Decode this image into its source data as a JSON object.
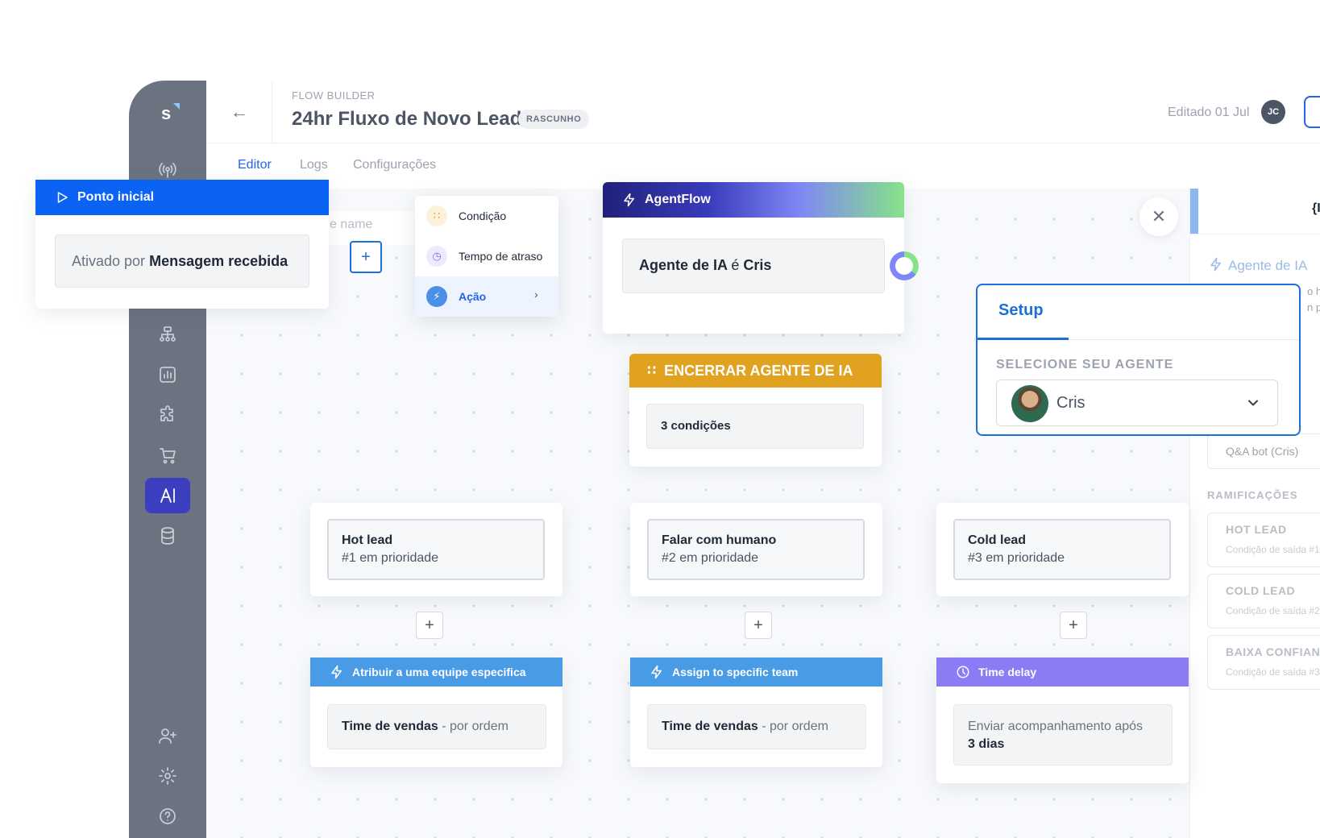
{
  "app": {
    "logo_letter": "s",
    "breadcrumb": "FLOW BUILDER",
    "title": "24hr Fluxo de Novo Lead",
    "status_badge": "RASCUNHO",
    "edited": "Editado 01 Jul",
    "user_initials": "JC"
  },
  "tabs": [
    "Editor",
    "Logs",
    "Configurações"
  ],
  "sidebar": {
    "icons": [
      "broadcast-icon",
      "flow-tree-icon",
      "chart-icon",
      "puzzle-icon",
      "cart-icon",
      "ai-icon",
      "database-icon",
      "add-user-icon",
      "gear-icon",
      "help-icon"
    ],
    "active": "ai-icon"
  },
  "canvas": {
    "name_placeholder_fragment": "e name",
    "start_node": {
      "title": "Ponto inicial",
      "trigger_prefix": "Ativado por",
      "trigger_value": "Mensagem recebida",
      "color": "#0b63f6"
    },
    "menu": {
      "items": [
        "Condição",
        "Tempo de atraso",
        "Ação"
      ],
      "active": "Ação"
    },
    "agentflow_node": {
      "title": "AgentFlow",
      "body_prefix": "Agente de IA",
      "body_mid": "é",
      "body_value": "Cris"
    },
    "end_node": {
      "title": "ENCERRAR AGENTE DE IA",
      "body": "3 condições",
      "color": "#e0a21f"
    },
    "branches": [
      {
        "title": "Hot lead",
        "subtitle": "#1 em prioridade"
      },
      {
        "title": "Falar com humano",
        "subtitle": "#2 em prioridade"
      },
      {
        "title": "Cold lead",
        "subtitle": "#3 em prioridade"
      }
    ],
    "actions": [
      {
        "title": "Atribuir a uma equipe especifica",
        "body_bold": "Time de vendas",
        "body_rest": "- por ordem",
        "color": "#4a9be6"
      },
      {
        "title": "Assign to specific team",
        "body_bold": "Time de vendas",
        "body_rest": "- por ordem",
        "color": "#4a9be6"
      },
      {
        "title": "Time delay",
        "body_line1": "Enviar acompanhamento após",
        "body_bold": "3 dias",
        "color": "#8b7cf6"
      }
    ]
  },
  "setup_panel": {
    "tab": "Setup",
    "label": "SELECIONE SEU AGENTE",
    "selected_agent": "Cris"
  },
  "right_panel": {
    "header_fragment": "{I",
    "agent_label": "Agente de IA",
    "desc_fragment_1": "o h",
    "desc_fragment_2": "n p",
    "bot_value": "Q&A bot (Cris)",
    "section_title": "RAMIFICAÇÕES",
    "branches": [
      {
        "title": "HOT LEAD",
        "subtitle": "Condição de saída #1"
      },
      {
        "title": "COLD LEAD",
        "subtitle": "Condição de saída #2"
      },
      {
        "title": "BAIXA CONFIANÇ",
        "subtitle": "Condição de saída #3"
      }
    ]
  }
}
